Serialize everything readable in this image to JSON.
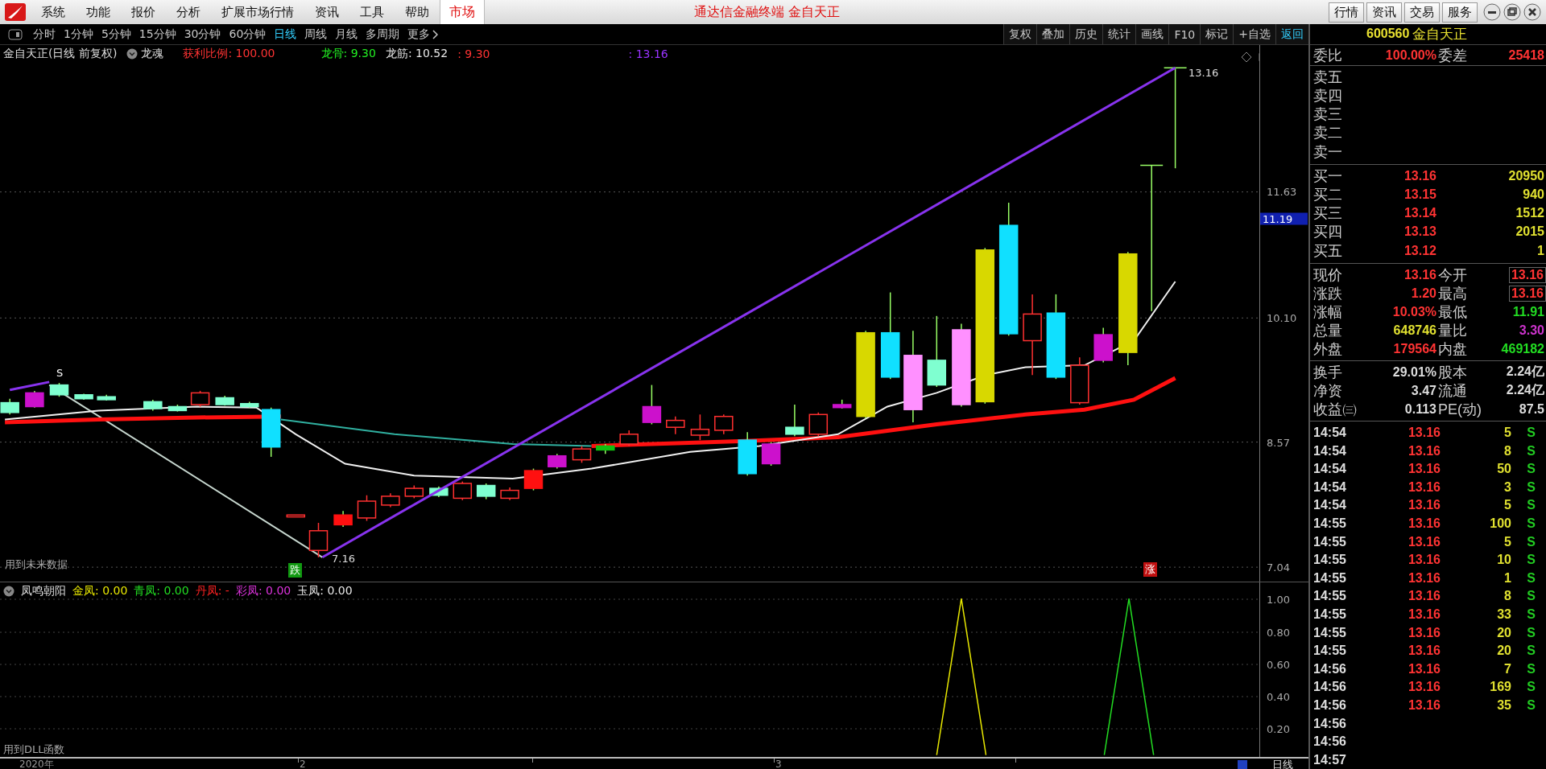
{
  "title_bar": {
    "menu": [
      {
        "label": "系统"
      },
      {
        "label": "功能"
      },
      {
        "label": "报价"
      },
      {
        "label": "分析"
      },
      {
        "label": "扩展市场行情"
      },
      {
        "label": "资讯"
      },
      {
        "label": "工具"
      },
      {
        "label": "帮助"
      }
    ],
    "market_tab": "市场",
    "title": "通达信金融终端 金自天正",
    "buttons": [
      "行情",
      "资讯",
      "交易",
      "服务"
    ]
  },
  "toolbar": {
    "periods": [
      {
        "label": "分时",
        "selected": false
      },
      {
        "label": "1分钟",
        "selected": false
      },
      {
        "label": "5分钟",
        "selected": false
      },
      {
        "label": "15分钟",
        "selected": false
      },
      {
        "label": "30分钟",
        "selected": false
      },
      {
        "label": "60分钟",
        "selected": false
      },
      {
        "label": "日线",
        "selected": true
      },
      {
        "label": "周线",
        "selected": false
      },
      {
        "label": "月线",
        "selected": false
      },
      {
        "label": "多周期",
        "selected": false
      }
    ],
    "more": "更多",
    "tools": [
      {
        "label": "复权",
        "kind": "tool"
      },
      {
        "label": "叠加",
        "kind": "tool"
      },
      {
        "label": "历史",
        "kind": "tool"
      },
      {
        "label": "统计",
        "kind": "tool"
      },
      {
        "label": "画线",
        "kind": "tool"
      },
      {
        "label": "F10",
        "kind": "tool"
      },
      {
        "label": "标记",
        "kind": "tool"
      },
      {
        "label": "+自选",
        "kind": "tool"
      },
      {
        "label": "返回",
        "kind": "back"
      }
    ]
  },
  "stock_header": {
    "code": "600560",
    "name": "金自天正"
  },
  "main_chart": {
    "title": "金自天正(日线 前复权)",
    "indicator": "龙魂",
    "values": [
      {
        "text": "获利比例: 100.00",
        "color": "#ff3333"
      },
      {
        "text": "龙骨: 9.30",
        "color": "#22ee22"
      },
      {
        "text": "龙筋: 10.52",
        "color": "#e8e8e8"
      },
      {
        "text": ": 9.30",
        "color": "#ff3333"
      },
      {
        "text": ": 13.16",
        "color": "#9933ff"
      }
    ],
    "annotations": [
      {
        "text": "S",
        "kind": "mark"
      },
      {
        "text": "7.16",
        "kind": "price"
      },
      {
        "text": "跌",
        "kind": "down"
      },
      {
        "text": "13.16",
        "kind": "price"
      },
      {
        "text": "涨",
        "kind": "up"
      },
      {
        "text": "用到未来数据",
        "kind": "note"
      }
    ],
    "y_axis": [
      "11.63",
      "10.10",
      "8.57",
      "7.04"
    ],
    "price_tag": "11.19"
  },
  "indicator_pane": {
    "title": "凤鸣朝阳",
    "values": [
      {
        "text": "金凤: 0.00",
        "color": "#e8e800"
      },
      {
        "text": "青凤: 0.00",
        "color": "#22dd22"
      },
      {
        "text": "丹凤: -",
        "color": "#ff2222"
      },
      {
        "text": "彩凤: 0.00",
        "color": "#dd33dd"
      },
      {
        "text": "玉凤: 0.00",
        "color": "#e8e8e8"
      }
    ],
    "note": "用到DLL函数",
    "y_axis": [
      "1.00",
      "0.80",
      "0.60",
      "0.40",
      "0.20"
    ]
  },
  "x_axis": {
    "labels": [
      "2020年",
      "2",
      "3"
    ],
    "period": "日线"
  },
  "quote_panel": {
    "order_ratio": {
      "label": "委比",
      "value": "100.00%",
      "label_2": "委差",
      "value_2": "25418"
    },
    "asks": [
      "卖五",
      "卖四",
      "卖三",
      "卖二",
      "卖一"
    ],
    "bids": [
      {
        "label": "买一",
        "price": "13.16",
        "volume": "20950"
      },
      {
        "label": "买二",
        "price": "13.15",
        "volume": "940"
      },
      {
        "label": "买三",
        "price": "13.14",
        "volume": "1512"
      },
      {
        "label": "买四",
        "price": "13.13",
        "volume": "2015"
      },
      {
        "label": "买五",
        "price": "13.12",
        "volume": "1"
      }
    ],
    "stats": [
      {
        "label": "现价",
        "value": "13.16",
        "color": "#ff3333",
        "boxed": false
      },
      {
        "label": "今开",
        "value": "13.16",
        "color": "#ff3333",
        "boxed": true
      },
      {
        "label": "涨跌",
        "value": "1.20",
        "color": "#ff3333",
        "boxed": false
      },
      {
        "label": "最高",
        "value": "13.16",
        "color": "#ff3333",
        "boxed": true
      },
      {
        "label": "涨幅",
        "value": "10.03%",
        "color": "#ff3333",
        "boxed": false
      },
      {
        "label": "最低",
        "value": "11.91",
        "color": "#22dd22",
        "boxed": false
      },
      {
        "label": "总量",
        "value": "648746",
        "color": "#e0e030",
        "boxed": false
      },
      {
        "label": "量比",
        "value": "3.30",
        "color": "#cc33cc",
        "boxed": false
      },
      {
        "label": "外盘",
        "value": "179564",
        "color": "#ff3333",
        "boxed": false
      },
      {
        "label": "内盘",
        "value": "469182",
        "color": "#22dd22",
        "boxed": false
      }
    ],
    "capital": [
      {
        "label": "换手",
        "value": "29.01%"
      },
      {
        "label": "股本",
        "value": "2.24亿"
      },
      {
        "label": "净资",
        "value": "3.47"
      },
      {
        "label": "流通",
        "value": "2.24亿"
      },
      {
        "label": "收益㈢",
        "value": "0.113"
      },
      {
        "label": "PE(动)",
        "value": "87.5"
      }
    ],
    "ticks": [
      {
        "time": "14:54",
        "price": "13.16",
        "volume": "5",
        "side": "S"
      },
      {
        "time": "14:54",
        "price": "13.16",
        "volume": "8",
        "side": "S"
      },
      {
        "time": "14:54",
        "price": "13.16",
        "volume": "50",
        "side": "S"
      },
      {
        "time": "14:54",
        "price": "13.16",
        "volume": "3",
        "side": "S"
      },
      {
        "time": "14:54",
        "price": "13.16",
        "volume": "5",
        "side": "S"
      },
      {
        "time": "14:55",
        "price": "13.16",
        "volume": "100",
        "side": "S"
      },
      {
        "time": "14:55",
        "price": "13.16",
        "volume": "5",
        "side": "S"
      },
      {
        "time": "14:55",
        "price": "13.16",
        "volume": "10",
        "side": "S"
      },
      {
        "time": "14:55",
        "price": "13.16",
        "volume": "1",
        "side": "S"
      },
      {
        "time": "14:55",
        "price": "13.16",
        "volume": "8",
        "side": "S"
      },
      {
        "time": "14:55",
        "price": "13.16",
        "volume": "33",
        "side": "S"
      },
      {
        "time": "14:55",
        "price": "13.16",
        "volume": "20",
        "side": "S"
      },
      {
        "time": "14:55",
        "price": "13.16",
        "volume": "20",
        "side": "S"
      },
      {
        "time": "14:56",
        "price": "13.16",
        "volume": "7",
        "side": "S"
      },
      {
        "time": "14:56",
        "price": "13.16",
        "volume": "169",
        "side": "S"
      },
      {
        "time": "14:56",
        "price": "13.16",
        "volume": "35",
        "side": "S"
      },
      {
        "time": "14:56"
      },
      {
        "time": "14:56"
      },
      {
        "time": "14:57"
      }
    ]
  }
}
